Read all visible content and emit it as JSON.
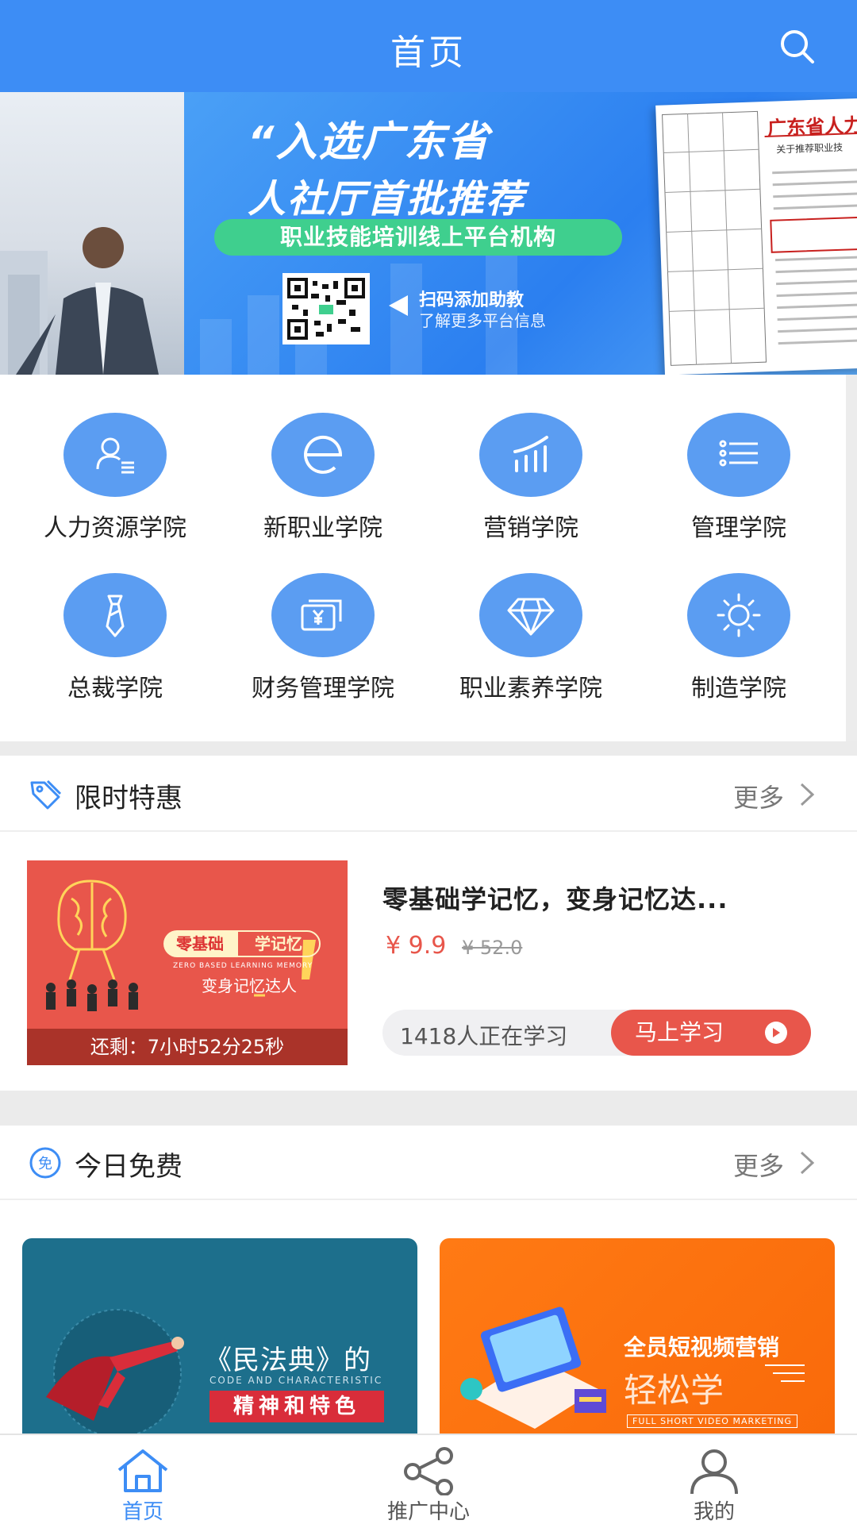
{
  "header": {
    "title": "首页",
    "search_icon": "search-icon"
  },
  "banner": {
    "headline_1": "“入选广东省",
    "headline_2": "人社厅首批推荐",
    "pill": "职业技能培训线上平台机构",
    "scan_title": "扫码添加助教",
    "scan_sub": "了解更多平台信息",
    "doc_title": "广东省人力",
    "doc_sub": "关于推荐职业技",
    "dots": 3,
    "active_dot": 1
  },
  "categories": [
    {
      "label": "人力资源学院",
      "icon": "person-list-icon"
    },
    {
      "label": "新职业学院",
      "icon": "e-letter-icon"
    },
    {
      "label": "营销学院",
      "icon": "growth-chart-icon"
    },
    {
      "label": "管理学院",
      "icon": "list-icon"
    },
    {
      "label": "总裁学院",
      "icon": "tie-icon"
    },
    {
      "label": "财务管理学院",
      "icon": "money-icon"
    },
    {
      "label": "职业素养学院",
      "icon": "diamond-icon"
    },
    {
      "label": "制造学院",
      "icon": "sun-icon"
    }
  ],
  "flash_sale": {
    "title": "限时特惠",
    "more": "更多",
    "course": {
      "title": "零基础学记忆，变身记忆达...",
      "price": "¥ 9.9",
      "old_price": "¥ 52.0",
      "learners": "1418人正在学习",
      "button": "马上学习",
      "timer": "还剩：7小时52分25秒",
      "badge_1": "零基础",
      "badge_2": "学记忆",
      "image_en": "ZERO BASED LEARNING MEMORY",
      "image_sub": "变身记忆达人"
    }
  },
  "free_today": {
    "title": "今日免费",
    "more": "更多",
    "courses": [
      {
        "title": "《民法典》的",
        "en": "CODE AND CHARACTERISTIC",
        "pill": "精神和特色"
      },
      {
        "title": "全员短视频营销",
        "big": "轻松学",
        "en": "FULL SHORT VIDEO MARKETING"
      }
    ]
  },
  "tabs": [
    {
      "label": "首页",
      "icon": "home-icon",
      "active": true
    },
    {
      "label": "推广中心",
      "icon": "share-icon",
      "active": false
    },
    {
      "label": "我的",
      "icon": "user-icon",
      "active": false
    }
  ],
  "colors": {
    "primary": "#3d8df5",
    "accent": "#e8564b",
    "icon_bg": "#5b9df2"
  }
}
